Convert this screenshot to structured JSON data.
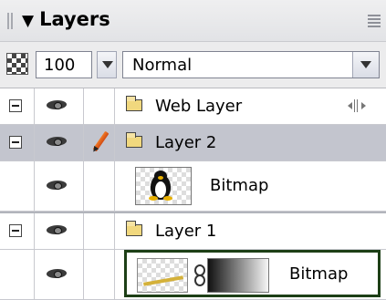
{
  "panel": {
    "title": "Layers",
    "opacity": "100",
    "blend_mode": "Normal"
  },
  "layers": [
    {
      "name": "Web Layer"
    },
    {
      "name": "Layer 2",
      "selected": true,
      "sub": "Bitmap"
    },
    {
      "name": "Layer 1",
      "sub": "Bitmap"
    }
  ],
  "icons": {
    "header": "triangle-down-icon",
    "menu": "panel-menu-icon",
    "alpha": "checker-icon",
    "eye": "eye-icon",
    "pencil": "pencil-icon",
    "folder": "folder-icon",
    "web": "web-layer-icon",
    "chain": "link-chain-icon"
  }
}
